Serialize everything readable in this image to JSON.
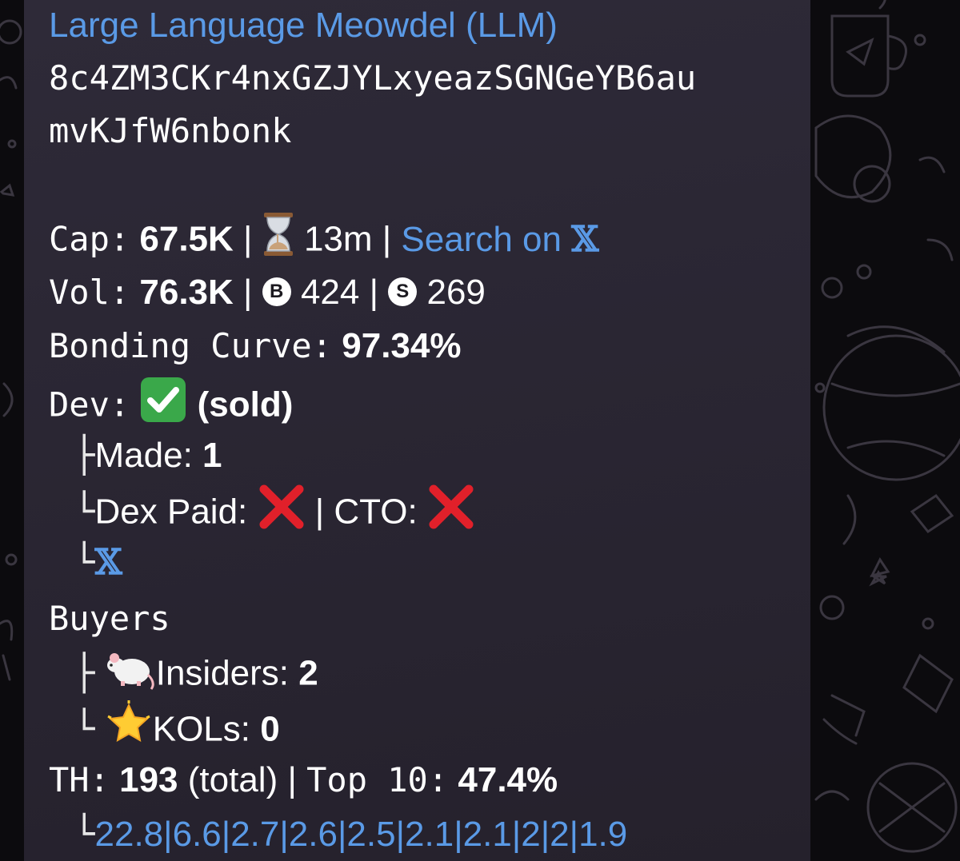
{
  "message": {
    "title": "Large Language Meowdel (LLM)",
    "address_line1": "8c4ZM3CKr4nxGZJYLxyeazSGNGeYB6au",
    "address_line2": "mvKJfW6nbonk",
    "cap_label": "Cap:",
    "cap_value": "67.5K",
    "age": "13m",
    "search_link": "Search on",
    "x_glyph": "𝕏",
    "vol_label": "Vol:",
    "vol_value": "76.3K",
    "buy_badge": "B",
    "buys": "424",
    "sell_badge": "S",
    "sells": "269",
    "bonding_label": "Bonding Curve:",
    "bonding_value": "97.34%",
    "dev_label": "Dev:",
    "dev_status": "(sold)",
    "made_label": "Made:",
    "made_value": "1",
    "dex_paid_label": "Dex Paid:",
    "cto_label": "CTO:",
    "buyers_label": "Buyers",
    "insiders_label": "Insiders:",
    "insiders_value": "2",
    "kols_label": "KOLs:",
    "kols_value": "0",
    "th_label": "TH:",
    "th_value": "193",
    "th_total": "(total)",
    "top10_label": "Top 10:",
    "top10_value": "47.4%",
    "holders": [
      "22.8",
      "6.6",
      "2.7",
      "2.6",
      "2.5",
      "2.1",
      "2.1",
      "2",
      "2",
      "1.9"
    ]
  },
  "colors": {
    "link": "#5a9ae6",
    "bubble": "#2a2633",
    "background": "#0c0b0e",
    "check": "#3aa84a",
    "cross": "#e1202a"
  },
  "icons": [
    "hourglass-icon",
    "check-icon",
    "cross-icon",
    "x-logo-icon",
    "rat-icon",
    "star-icon"
  ]
}
